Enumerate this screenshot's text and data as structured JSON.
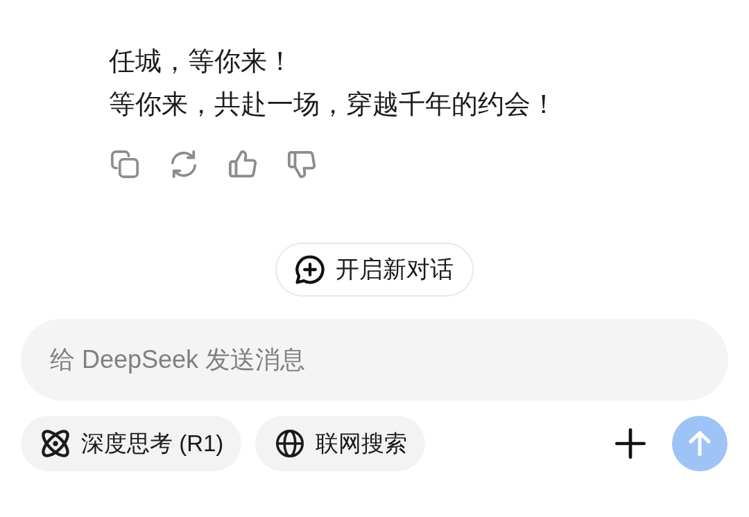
{
  "message": {
    "lines": [
      "任城，等你来！",
      "等你来，共赴一场，穿越千年的约会！"
    ]
  },
  "new_chat_button": {
    "label": "开启新对话"
  },
  "composer": {
    "placeholder": "给 DeepSeek 发送消息",
    "toggles": [
      {
        "label": "深度思考 (R1)",
        "on": false
      },
      {
        "label": "联网搜索",
        "on": false
      }
    ],
    "send_button": {
      "disabled": true
    }
  }
}
